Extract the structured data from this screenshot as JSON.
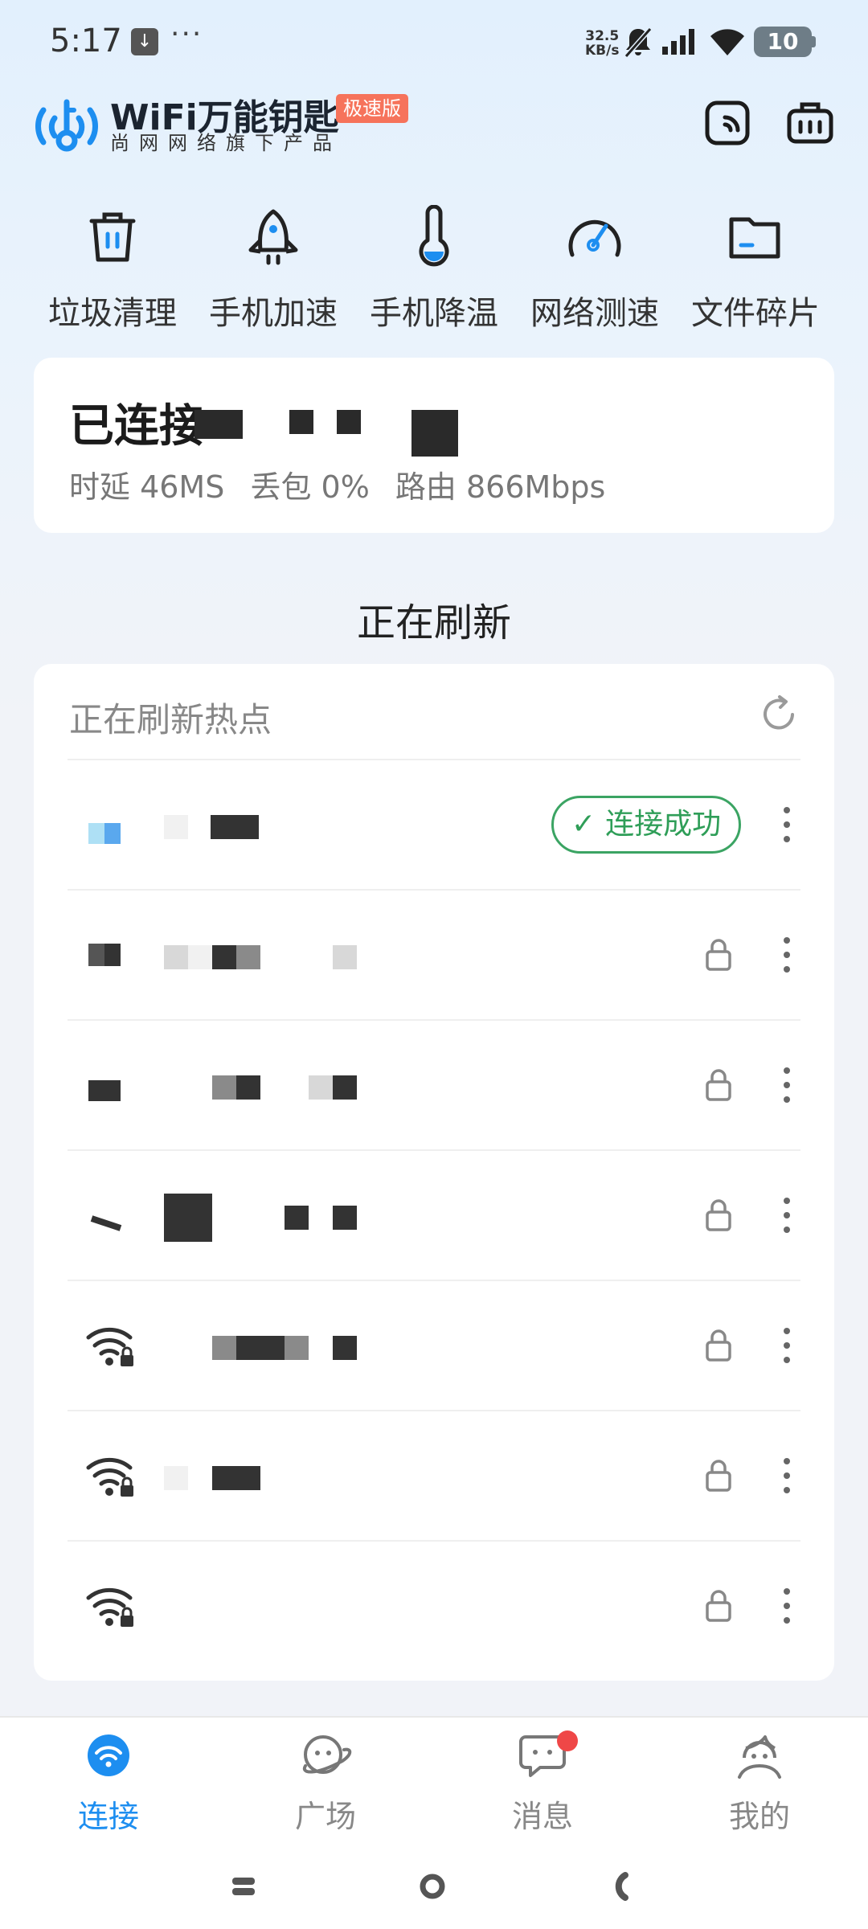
{
  "status_bar": {
    "time": "5:17",
    "download_glyph": "↓",
    "more_glyph": "···",
    "net_speed_value": "32.5",
    "net_speed_unit": "KB/s",
    "battery": "10",
    "icons": [
      "mute-bell-icon",
      "cell-signal-icon",
      "wifi-icon",
      "battery-icon"
    ]
  },
  "header": {
    "brand_name": "WiFi万能钥匙",
    "brand_badge": "极速版",
    "brand_sub": "尚网网络旗下产品",
    "colors": {
      "brand_blue": "#1d8ef0",
      "badge": "#f6735b"
    }
  },
  "tools": [
    {
      "label": "垃圾清理",
      "icon": "trash-icon"
    },
    {
      "label": "手机加速",
      "icon": "rocket-icon"
    },
    {
      "label": "手机降温",
      "icon": "thermometer-icon"
    },
    {
      "label": "网络测速",
      "icon": "speedometer-icon"
    },
    {
      "label": "文件碎片",
      "icon": "folder-icon"
    }
  ],
  "connection": {
    "title_prefix": "已连接",
    "latency": "时延 46MS",
    "packet_loss": "丢包 0%",
    "route": "路由 866Mbps"
  },
  "refresh_title": "正在刷新",
  "hotspots": {
    "header": "正在刷新热点",
    "success_label": "连接成功",
    "accent_green": "#2f9e58",
    "rows": [
      {
        "state": "connected",
        "locked": false
      },
      {
        "state": "available",
        "locked": true
      },
      {
        "state": "available",
        "locked": true
      },
      {
        "state": "available",
        "locked": true
      },
      {
        "state": "available",
        "locked": true
      },
      {
        "state": "available",
        "locked": true
      },
      {
        "state": "available",
        "locked": true
      }
    ]
  },
  "bottom_nav": {
    "items": [
      {
        "label": "连接",
        "icon": "wifi-nav-icon",
        "active": true
      },
      {
        "label": "广场",
        "icon": "plaza-icon",
        "active": false
      },
      {
        "label": "消息",
        "icon": "message-icon",
        "active": false,
        "badge": true
      },
      {
        "label": "我的",
        "icon": "profile-icon",
        "active": false
      }
    ]
  }
}
